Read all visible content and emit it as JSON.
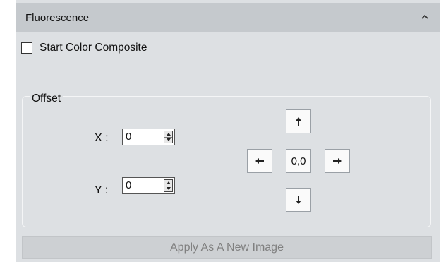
{
  "panel": {
    "title": "Fluorescence",
    "collapse_icon": "chevron-up-icon"
  },
  "composite": {
    "label": "Start Color Composite",
    "checked": false
  },
  "offset": {
    "legend": "Offset",
    "x_label": "X :",
    "x_value": "0",
    "y_label": "Y :",
    "y_value": "0",
    "reset_label": "0,0",
    "icons": {
      "up": "arrow-up-icon",
      "down": "arrow-down-icon",
      "left": "arrow-left-icon",
      "right": "arrow-right-icon"
    }
  },
  "apply_button": {
    "label": "Apply As A New Image",
    "enabled": false
  }
}
